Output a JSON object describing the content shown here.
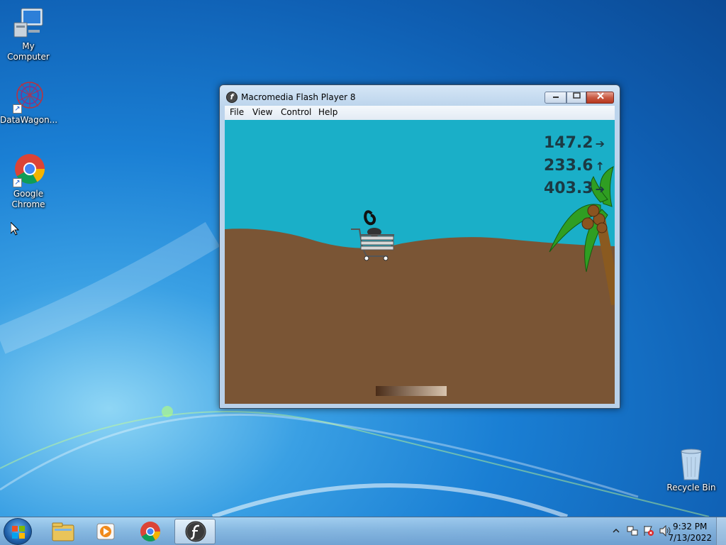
{
  "desktop": {
    "icons": [
      {
        "label": "My Computer",
        "icon": "computer-icon"
      },
      {
        "label": "DataWagon...",
        "icon": "datawagon-icon",
        "shortcut": true
      },
      {
        "label": "Google Chrome",
        "icon": "chrome-icon",
        "shortcut": true
      },
      {
        "label": "Recycle Bin",
        "icon": "recycle-bin-icon"
      }
    ]
  },
  "window": {
    "title": "Macromedia Flash Player 8",
    "controls": {
      "minimize": "minimize",
      "maximize": "maximize",
      "close": "close"
    },
    "menu": [
      "File",
      "View",
      "Control",
      "Help"
    ]
  },
  "game": {
    "hud": [
      {
        "value": "147.2",
        "arrow": "➔"
      },
      {
        "value": "233.6",
        "arrow": "↑"
      },
      {
        "value": "403.3",
        "arrow": "➔"
      }
    ],
    "colors": {
      "sky": "#1aafc8",
      "ground": "#7a5535",
      "palm_leaf": "#2f9e22",
      "trunk": "#8a5a20",
      "coconut": "#8a5420"
    }
  },
  "taskbar": {
    "pinned": [
      "windows-explorer-icon",
      "media-player-icon",
      "chrome-icon",
      "flash-player-icon"
    ],
    "tray_icons": [
      "show-hidden-icons-chevron",
      "network-icon",
      "action-center-icon",
      "volume-icon"
    ],
    "time": "9:32 PM",
    "date": "7/13/2022"
  }
}
